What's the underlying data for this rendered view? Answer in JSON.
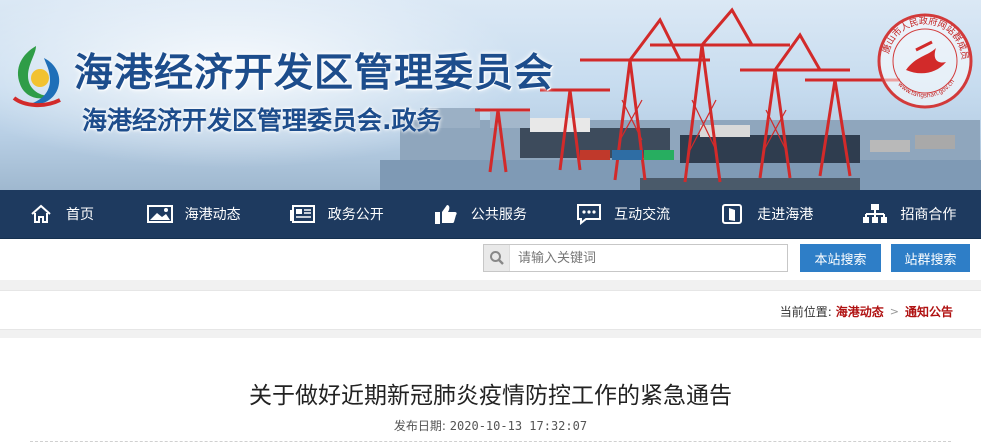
{
  "header": {
    "title": "海港经济开发区管理委员会",
    "subtitle": "海港经济开发区管理委员会.政务",
    "seal_text": "唐山市人民政府网站群成员",
    "seal_url": "www.tangshan.gov.cn"
  },
  "nav": {
    "items": [
      {
        "label": "首页",
        "icon": "home-icon"
      },
      {
        "label": "海港动态",
        "icon": "picture-icon"
      },
      {
        "label": "政务公开",
        "icon": "newspaper-icon"
      },
      {
        "label": "公共服务",
        "icon": "thumbs-up-icon"
      },
      {
        "label": "互动交流",
        "icon": "chat-icon"
      },
      {
        "label": "走进海港",
        "icon": "door-icon"
      },
      {
        "label": "招商合作",
        "icon": "sitemap-icon"
      }
    ]
  },
  "search": {
    "placeholder": "请输入关键词",
    "site_search_label": "本站搜索",
    "group_search_label": "站群搜索"
  },
  "breadcrumb": {
    "prefix": "当前位置:",
    "items": [
      "海港动态",
      "通知公告"
    ]
  },
  "article": {
    "title": "关于做好近期新冠肺炎疫情防控工作的紧急通告",
    "date_label": "发布日期:",
    "date_value": "2020-10-13 17:32:07"
  },
  "colors": {
    "nav_bg": "#1e3a5f",
    "button_bg": "#2e7ec7",
    "title_blue": "#1d4d8c",
    "breadcrumb_red": "#b01212",
    "crane_red": "#d22a2a"
  }
}
